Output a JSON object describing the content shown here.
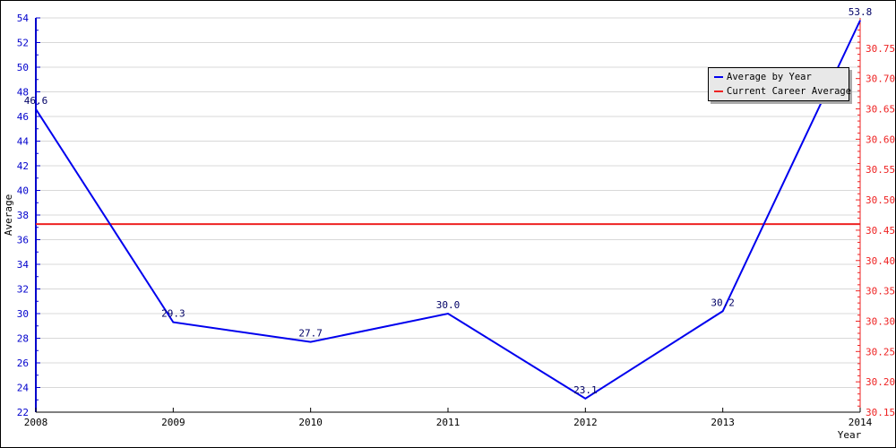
{
  "chart_data": {
    "type": "line",
    "xlabel": "Year",
    "ylabel": "Average",
    "x": [
      "2008",
      "2009",
      "2010",
      "2011",
      "2012",
      "2013",
      "2014"
    ],
    "series": [
      {
        "name": "Average by Year",
        "axis": "left",
        "color": "#0000ee",
        "values": [
          46.6,
          29.3,
          27.7,
          30.0,
          23.1,
          30.2,
          53.8
        ],
        "labels": [
          "46.6",
          "29.3",
          "27.7",
          "30.0",
          "23.1",
          "30.2",
          "53.8"
        ]
      },
      {
        "name": "Current Career Average",
        "axis": "right",
        "color": "#ee2222",
        "value": 30.46
      }
    ],
    "ylim": [
      22,
      54
    ],
    "yticks": [
      "22",
      "24",
      "26",
      "28",
      "30",
      "32",
      "34",
      "36",
      "38",
      "40",
      "42",
      "44",
      "46",
      "48",
      "50",
      "52",
      "54"
    ],
    "y2lim": [
      30.15,
      30.8
    ],
    "y2ticks": [
      "30.15",
      "30.20",
      "30.25",
      "30.30",
      "30.35",
      "30.40",
      "30.45",
      "30.50",
      "30.55",
      "30.60",
      "30.65",
      "30.70",
      "30.75"
    ],
    "grid": true,
    "legend": "top-right",
    "left_axis_color": "#0000cc",
    "right_axis_color": "#ee2222"
  }
}
